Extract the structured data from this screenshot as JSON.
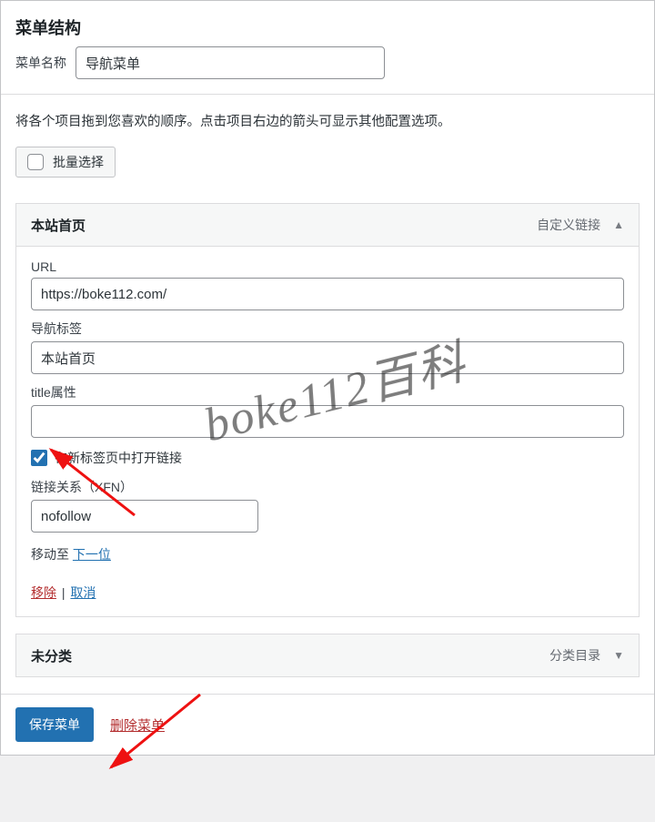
{
  "header": {
    "title": "菜单结构"
  },
  "menuName": {
    "label": "菜单名称",
    "value": "导航菜单"
  },
  "instructions": "将各个项目拖到您喜欢的顺序。点击项目右边的箭头可显示其他配置选项。",
  "bulkSelect": {
    "label": "批量选择"
  },
  "items": [
    {
      "title": "本站首页",
      "typeLabel": "自定义链接",
      "expanded": true,
      "fields": {
        "urlLabel": "URL",
        "urlValue": "https://boke112.com/",
        "navLabel": "导航标签",
        "navValue": "本站首页",
        "titleAttrLabel": "title属性",
        "titleAttrValue": "",
        "newTabLabel": "在新标签页中打开链接",
        "newTabChecked": true,
        "xfnLabel": "链接关系（XFN）",
        "xfnValue": "nofollow",
        "moveLabel": "移动至",
        "moveNext": "下一位",
        "removeLabel": "移除",
        "cancelLabel": "取消"
      }
    },
    {
      "title": "未分类",
      "typeLabel": "分类目录",
      "expanded": false
    }
  ],
  "footer": {
    "saveLabel": "保存菜单",
    "deleteLabel": "删除菜单"
  },
  "watermark": "boke112百科"
}
